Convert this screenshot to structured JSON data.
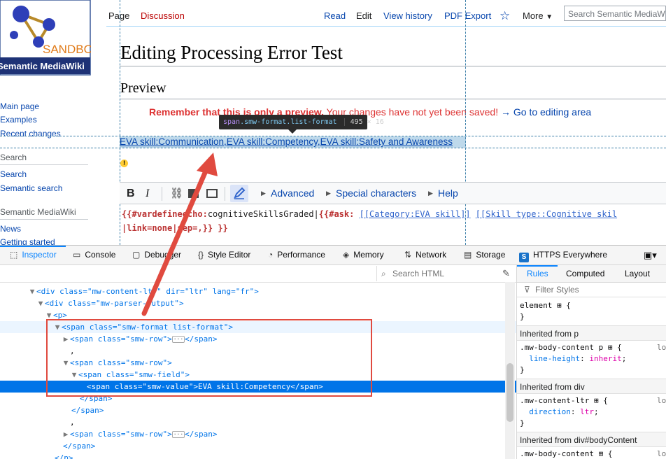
{
  "logo": {
    "badge": "SANDBOX",
    "name": "Semantic MediaWiki"
  },
  "sidebar": {
    "nav": [
      "Main page",
      "Examples",
      "Recent changes"
    ],
    "search_heading": "Search",
    "search_links": [
      "Search",
      "Semantic search"
    ],
    "smw_heading": "Semantic MediaWiki",
    "smw_links": [
      "News",
      "Getting started"
    ]
  },
  "tabs": {
    "page": "Page",
    "discussion": "Discussion",
    "read": "Read",
    "edit": "Edit",
    "history": "View history",
    "pdf": "PDF Export",
    "more": "More",
    "search_placeholder": "Search Semantic MediaWiki"
  },
  "page": {
    "title": "Editing Processing Error Test",
    "preview_heading": "Preview",
    "notice_bold": "Remember that this is only a preview.",
    "notice_rest": " Your changes have not yet been saved! ",
    "notice_link": "→ Go to editing area",
    "result": "EVA skill:Communication,EVA skill:Competency,EVA skill:Safety and Awareness"
  },
  "tooltip": {
    "tag": "span",
    "classes": ".smw-format.list-format",
    "dims": "495 × 16"
  },
  "editor": {
    "bold": "B",
    "italic": "I",
    "advanced": "Advanced",
    "special": "Special characters",
    "help": "Help",
    "line1_a": "{{#vardefineecho:",
    "line1_b": "cognitiveSkillsGraded|",
    "line1_c": "{{#ask: ",
    "line1_d": "[[Category:EVA skill]]",
    "line1_e": " ",
    "line1_f": "[[Skill type::Cognitive skil",
    "line2": "|link=none|sep=,}} }}"
  },
  "devtools": {
    "tabs": [
      "Inspector",
      "Console",
      "Debugger",
      "Style Editor",
      "Performance",
      "Memory",
      "Network",
      "Storage",
      "HTTPS Everywhere"
    ],
    "search_html": "Search HTML",
    "markup": [
      {
        "attr": "",
        "text": ""
      },
      {
        "div1_tag": "div",
        "div1_a1": "class",
        "div1_v1": "\"mw-content-ltr\"",
        "div1_a2": "dir",
        "div1_v2": "\"ltr\"",
        "div1_a3": "lang",
        "div1_v3": "\"fr\""
      }
    ],
    "l1": "<div class=\"mw-content-ltr\" dir=\"ltr\" lang=\"fr\">",
    "l2": "<div class=\"mw-parser-output\">",
    "l3": "<p>",
    "l4": "<span class=\"smw-format list-format\">",
    "l5": "<span class=\"smw-row\">",
    "l5b": "</span>",
    "l6": ",",
    "l7": "<span class=\"smw-row\">",
    "l8": "<span class=\"smw-field\">",
    "l9": "<span class=\"smw-value\">EVA skill:Competency</span>",
    "l10": "</span>",
    "l11": "</span>",
    "l12": ",",
    "l13": "<span class=\"smw-row\">",
    "l13b": "</span>",
    "l14": "</span>",
    "l15": "</p>"
  },
  "rules": {
    "tabs": [
      "Rules",
      "Computed",
      "Layout"
    ],
    "filter": "Filter Styles",
    "element": "element",
    "inh_p": "Inherited from p",
    "sel_p": ".mw-body-content p",
    "prop_lh": "line-height",
    "val_lh": "inherit",
    "inh_div": "Inherited from div",
    "sel_div": ".mw-content-ltr",
    "prop_dir": "direction",
    "val_dir": "ltr",
    "inh_body": "Inherited from div#bodyContent",
    "sel_body": ".mw-body-content",
    "src": "lo"
  }
}
